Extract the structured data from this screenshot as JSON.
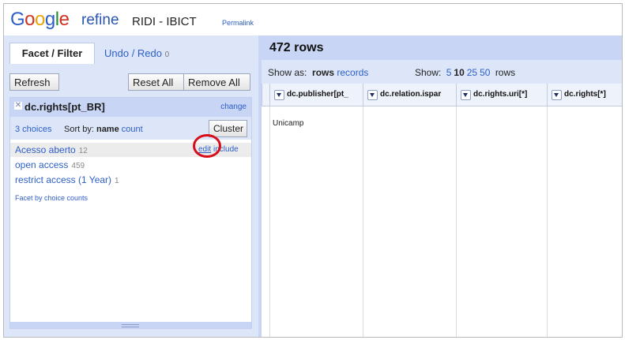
{
  "header": {
    "logo_google": [
      "G",
      "o",
      "o",
      "g",
      "l",
      "e"
    ],
    "logo_refine": "refine",
    "project_name": "RIDI - IBICT",
    "permalink": "Permalink"
  },
  "left_panel": {
    "tabs": [
      {
        "label": "Facet / Filter"
      },
      {
        "label": "Undo / Redo",
        "count": "0"
      }
    ],
    "buttons": {
      "refresh": "Refresh",
      "reset_all": "Reset All",
      "remove_all": "Remove All"
    },
    "facet": {
      "title": "dc.rights[pt_BR]",
      "change": "change",
      "choices_count": "3 choices",
      "sort_by_label": "Sort by:",
      "sort_name": "name",
      "sort_count": "count",
      "cluster": "Cluster",
      "choices": [
        {
          "label": "Acesso aberto",
          "count": "12"
        },
        {
          "label": "open access",
          "count": "459"
        },
        {
          "label": "restrict access (1 Year)",
          "count": "1"
        }
      ],
      "edit": "edit",
      "include": "include",
      "facet_by_counts": "Facet by choice counts"
    }
  },
  "right_panel": {
    "rows_count": "472 rows",
    "show_as_label": "Show as:",
    "show_as_rows": "rows",
    "show_as_records": "records",
    "show_label": "Show:",
    "page_sizes": [
      "5",
      "10",
      "25",
      "50"
    ],
    "page_size_selected": "10",
    "rows_suffix": "rows",
    "columns": [
      "dc.publisher[pt_",
      "dc.relation.ispar",
      "dc.rights.uri[*]",
      "dc.rights[*]"
    ],
    "first_cell": "Unicamp"
  },
  "colors": {
    "accent": "#2d5ec7",
    "panel": "#dde6f9",
    "header_band": "#c8d5f4",
    "highlight": "#d80e1a"
  }
}
